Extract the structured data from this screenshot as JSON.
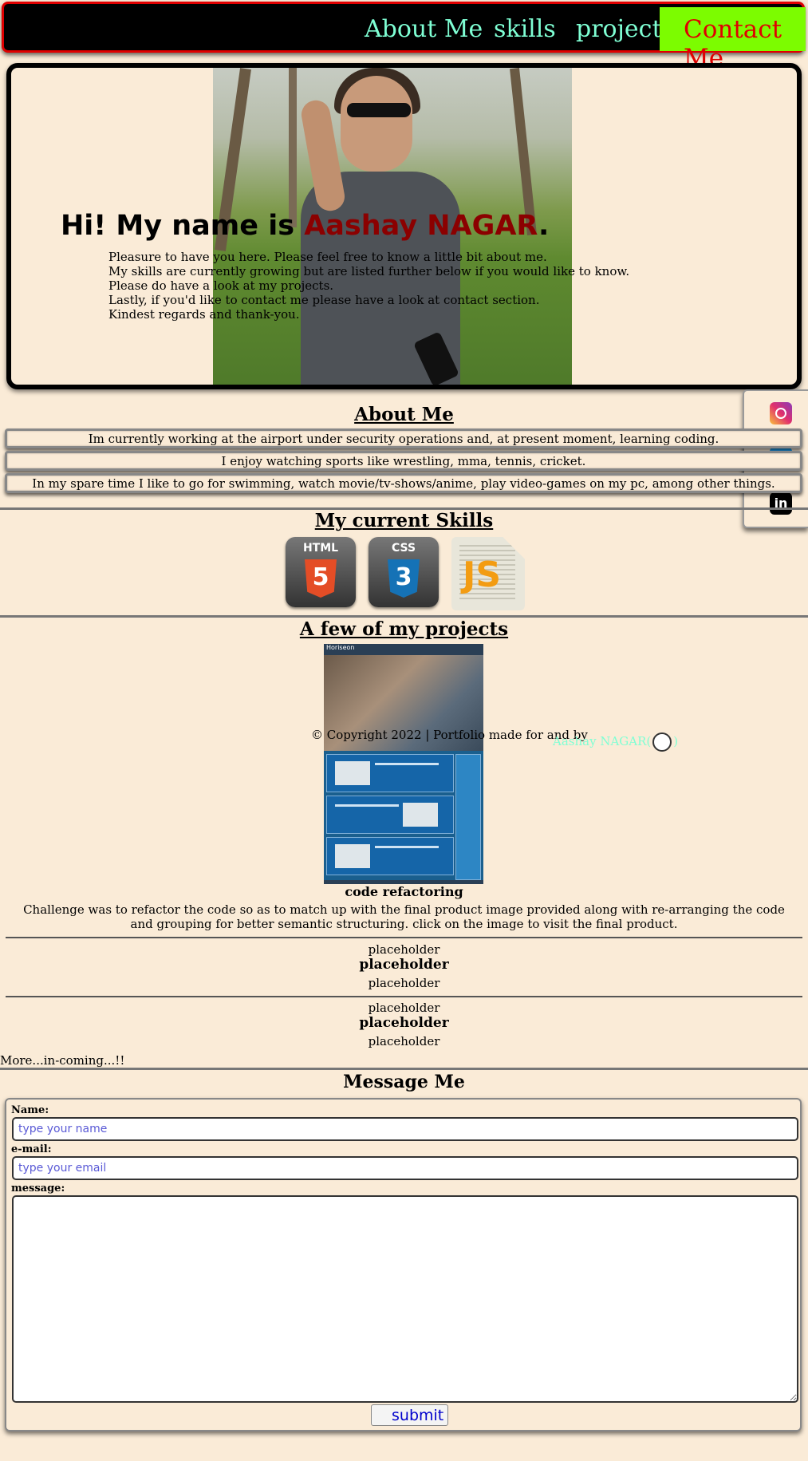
{
  "nav": {
    "about": "About Me",
    "skills": "skills",
    "projects": "projects",
    "contact": "Contact Me"
  },
  "hero": {
    "greeting": "Hi! My name is ",
    "name": "Aashay NAGAR",
    "period": ".",
    "intro": [
      "Pleasure to have you here. Please feel free to know a little bit about me.",
      "My skills are currently growing but are listed further below if you would like to know.",
      "Please do have a look at my projects.",
      "Lastly, if you'd like to contact me please have a look at contact section.",
      "Kindest regards and thank-you."
    ]
  },
  "social": {
    "icons": [
      "instagram-icon",
      "twitter-icon",
      "linkedin-icon"
    ],
    "linkedin_text": "in"
  },
  "about": {
    "heading": "About Me",
    "rows": [
      "Im currently working at the airport under security operations and, at present moment, learning coding.",
      "I enjoy watching sports like wrestling, mma, tennis, cricket.",
      "In my spare time I like to go for swimming, watch movie/tv-shows/anime, play video-games on my pc, among other things."
    ]
  },
  "skills": {
    "heading": "My current Skills",
    "items": [
      {
        "label": "HTML",
        "glyph": "5",
        "color": "#e44d26"
      },
      {
        "label": "CSS",
        "glyph": "3",
        "color": "#1572b6"
      },
      {
        "label": "JS",
        "color": "#f39c12"
      }
    ]
  },
  "projects": {
    "heading": "A few of my projects",
    "thumb_brand": "Horiseon",
    "footer": {
      "copyright": "© Copyright 2022 | Portfolio made for and by",
      "author": "Aashay NAGAR(",
      "close": ")"
    },
    "main": {
      "title": "code refactoring",
      "description": "Challenge was to refactor the code so as to match up with the final product image provided along with re-arranging the code and grouping for better semantic structuring. click on the image to visit the final product."
    },
    "placeholders": [
      {
        "top": "placeholder",
        "title": "placeholder",
        "bottom": "placeholder"
      },
      {
        "top": "placeholder",
        "title": "placeholder",
        "bottom": "placeholder"
      }
    ],
    "more": "More...in-coming...!!"
  },
  "contact": {
    "heading": "Message Me",
    "name_label": "Name:",
    "name_placeholder": "type your name",
    "email_label": "e-mail:",
    "email_placeholder": "type your email",
    "message_label": "message:",
    "submit": "submit"
  },
  "colors": {
    "background": "#faebd7",
    "nav_link": "#7fffd4",
    "contact_bg": "#7cfc00",
    "contact_text": "#e00000",
    "name": "#8b0000"
  }
}
